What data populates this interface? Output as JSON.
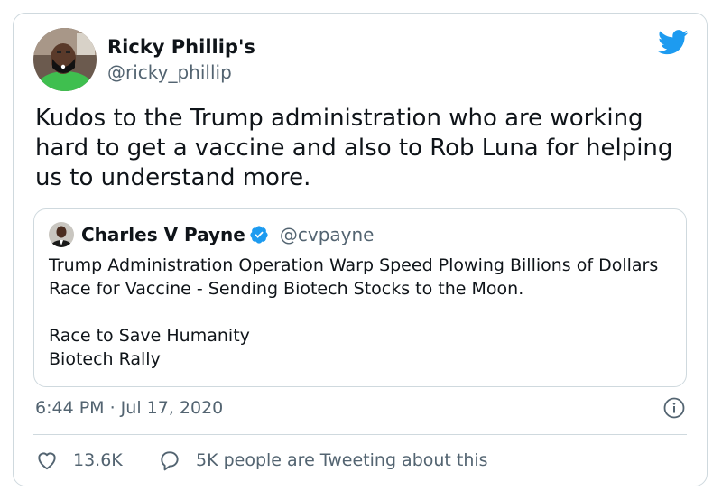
{
  "tweet": {
    "author_name": "Ricky Phillip's",
    "author_handle": "@ricky_phillip",
    "text": "Kudos to the Trump administration who are working hard to get a vaccine and also to Rob Luna for helping us to understand more.",
    "timestamp": "6:44 PM · Jul 17, 2020"
  },
  "quoted": {
    "author_name": "Charles V Payne",
    "author_handle": "@cvpayne",
    "line1": "Trump Administration Operation Warp Speed Plowing Billions of Dollars Race for Vaccine - Sending Biotech Stocks to the Moon.",
    "line2": "Race to Save Humanity",
    "line3": "Biotech Rally"
  },
  "actions": {
    "likes": "13.6K",
    "talking": "5K people are Tweeting about this"
  },
  "colors": {
    "brand": "#1d9bf0",
    "muted": "#536471",
    "border": "#cfd9de"
  },
  "icons": [
    "twitter-bird-icon",
    "verified-badge-icon",
    "info-icon",
    "heart-icon",
    "speech-bubble-icon"
  ]
}
